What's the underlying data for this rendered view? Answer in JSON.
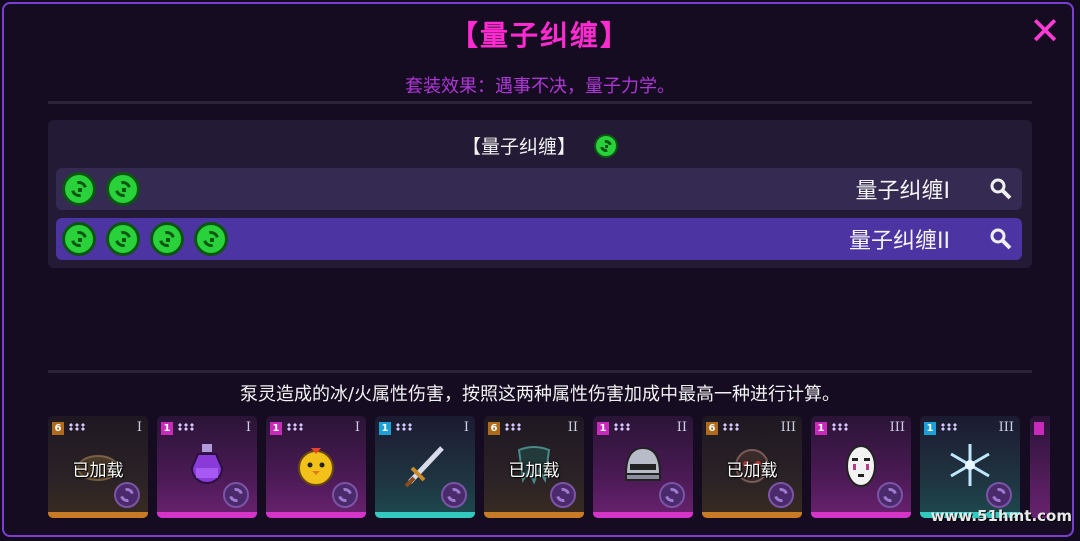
{
  "dialog": {
    "title": "【量子纠缠】",
    "close_icon": "close-icon",
    "set_effect": "套装效果：遇事不决，量子力学。"
  },
  "set_panel": {
    "header": "【量子纠缠】",
    "rows": [
      {
        "icon_count": 2,
        "label": "量子纠缠I",
        "selected": false
      },
      {
        "icon_count": 4,
        "label": "量子纠缠II",
        "selected": true
      }
    ]
  },
  "description": "泵灵造成的冰/火属性伤害，按照这两种属性伤害加成中最高一种进行计算。",
  "cards": [
    {
      "badge": "6",
      "tier": "I",
      "rarity": "brown",
      "loaded": "已加载",
      "art": "plate-icon"
    },
    {
      "badge": "1",
      "tier": "I",
      "rarity": "pink",
      "loaded": "",
      "art": "potion-icon"
    },
    {
      "badge": "1",
      "tier": "I",
      "rarity": "pink",
      "loaded": "",
      "art": "chick-icon"
    },
    {
      "badge": "1",
      "tier": "I",
      "rarity": "teal",
      "loaded": "",
      "art": "sword-icon"
    },
    {
      "badge": "6",
      "tier": "II",
      "rarity": "brown",
      "loaded": "已加载",
      "art": "tooth-icon"
    },
    {
      "badge": "1",
      "tier": "II",
      "rarity": "pink",
      "loaded": "",
      "art": "helmet-icon"
    },
    {
      "badge": "6",
      "tier": "III",
      "rarity": "brown",
      "loaded": "已加载",
      "art": "fiend-icon"
    },
    {
      "badge": "1",
      "tier": "III",
      "rarity": "pink",
      "loaded": "",
      "art": "mask-icon"
    },
    {
      "badge": "1",
      "tier": "III",
      "rarity": "teal",
      "loaded": "",
      "art": "snowflake-icon"
    }
  ],
  "watermark": "www.51hmt.com",
  "colors": {
    "title": "#ff2ad0",
    "subtitle": "#b035d8",
    "quantum_green": "#29d13a",
    "selected_row": "#4c34a2"
  }
}
